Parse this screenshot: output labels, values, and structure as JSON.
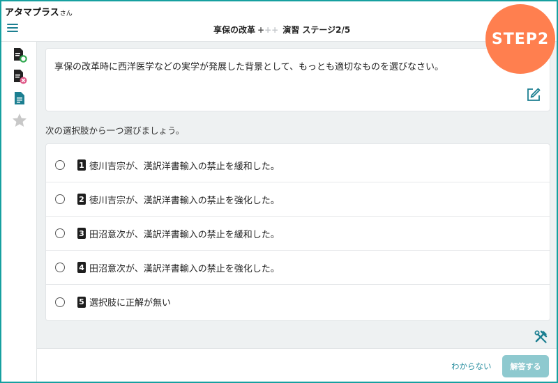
{
  "user": {
    "name": "アタマプラス",
    "suffix": "さん"
  },
  "header": {
    "title": "享保の改革",
    "plus_filled": "+",
    "plus_empty": "++",
    "stage": "演習 ステージ2/5"
  },
  "badge": {
    "label": "STEP2"
  },
  "sidebar": {
    "items": [
      {
        "icon": "correct-notes-icon"
      },
      {
        "icon": "wrong-notes-icon"
      },
      {
        "icon": "document-icon"
      },
      {
        "icon": "star-icon"
      }
    ]
  },
  "question": {
    "text": "享保の改革時に西洋医学などの実学が発展した背景として、もっとも適切なものを選びなさい。"
  },
  "instruction": "次の選択肢から一つ選びましょう。",
  "choices": [
    {
      "num": "1",
      "text": "徳川吉宗が、漢訳洋書輸入の禁止を緩和した。"
    },
    {
      "num": "2",
      "text": "徳川吉宗が、漢訳洋書輸入の禁止を強化した。"
    },
    {
      "num": "3",
      "text": "田沼意次が、漢訳洋書輸入の禁止を緩和した。"
    },
    {
      "num": "4",
      "text": "田沼意次が、漢訳洋書輸入の禁止を強化した。"
    },
    {
      "num": "5",
      "text": "選択肢に正解が無い"
    }
  ],
  "footer": {
    "dont_know": "わからない",
    "answer": "解答する"
  },
  "colors": {
    "accent": "#1c7f91",
    "badge": "#ff7f4f",
    "answer_button": "#8ec9cf",
    "frame": "#16a0a0"
  }
}
